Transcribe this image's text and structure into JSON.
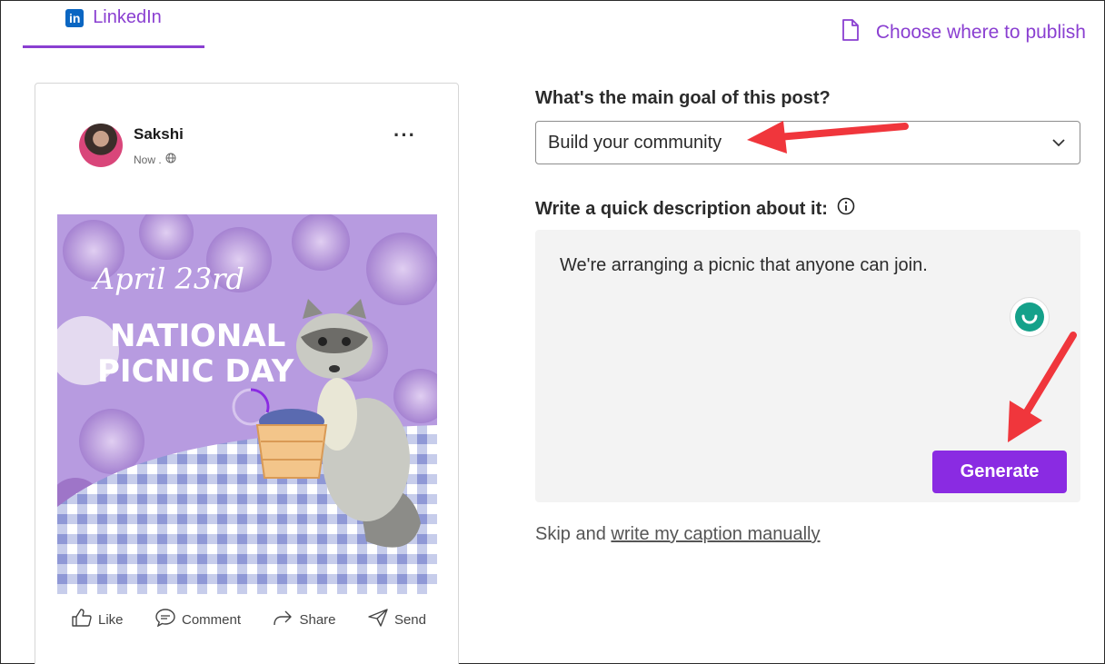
{
  "tab": {
    "label": "LinkedIn",
    "logo_text": "in"
  },
  "publish": {
    "label": "Choose where to publish"
  },
  "post": {
    "user_name": "Sakshi",
    "meta": "Now .",
    "image_script": "April 23rd",
    "image_title_1": "NATIONAL",
    "image_title_2": "PICNIC DAY",
    "actions": [
      "Like",
      "Comment",
      "Share",
      "Send"
    ]
  },
  "form": {
    "goal_question": "What's the main goal of this post?",
    "goal_value": "Build your community",
    "desc_question": "Write a quick description about it:",
    "desc_value": "We're arranging a picnic that anyone can join.",
    "generate_label": "Generate",
    "skip_prefix": "Skip and",
    "skip_link": "write my caption manually"
  },
  "colors": {
    "accent": "#8a2be2",
    "linkedin": "#0a66c2",
    "annotation_arrow": "#f0363c"
  }
}
